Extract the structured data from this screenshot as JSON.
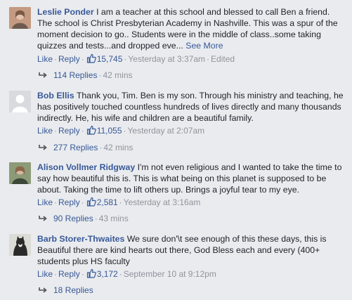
{
  "comments": [
    {
      "author": "Leslie Ponder",
      "text": "I am a teacher at this school and blessed to call Ben a friend. The school is Christ Presbyterian Academy in Nashville. This was a spur of the moment decision to go.. Students were in the middle of class..some taking quizzes and tests...and dropped eve...",
      "see_more": "See More",
      "like_label": "Like",
      "reply_label": "Reply",
      "likes": "15,745",
      "time": "Yesterday at 3:37am",
      "edited": "Edited",
      "replies": "114 Replies",
      "replies_time": "42 mins",
      "avatar_colors": [
        "#b98b74",
        "#6d5a4e"
      ]
    },
    {
      "author": "Bob Ellis",
      "text": "Thank you, Tim. Ben is my son. Through his ministry and teaching, he has positively touched countless hundreds of lives directly and many thousands indirectly. He, his wife and children are a beautiful family.",
      "like_label": "Like",
      "reply_label": "Reply",
      "likes": "11,055",
      "time": "Yesterday at 2:07am",
      "replies": "277 Replies",
      "replies_time": "42 mins",
      "avatar_colors": [
        "#bcc0c8",
        "#ffffff"
      ]
    },
    {
      "author": "Alison Vollmer Ridgway",
      "text": "I'm not even religious and I wanted to take the time to say how beautiful this is. This is what being on this planet is supposed to be about. Taking the time to lift others up. Brings a joyful tear to my eye.",
      "like_label": "Like",
      "reply_label": "Reply",
      "likes": "2,581",
      "time": "Yesterday at 3:16am",
      "replies": "90 Replies",
      "replies_time": "43 mins",
      "avatar_colors": [
        "#7b8a6a",
        "#3e4638"
      ]
    },
    {
      "author": "Barb Storer-Thwaites",
      "text": "We sure don'\\t see enough of this these days, this is Beautiful there are kind hearts out there, God Bless each and every (400+ students plus HS faculty",
      "like_label": "Like",
      "reply_label": "Reply",
      "likes": "3,172",
      "time": "September 10 at 9:12pm",
      "replies": "18 Replies",
      "avatar_colors": [
        "#d7d7d2",
        "#2a2a2a"
      ]
    }
  ],
  "colors": {
    "link": "#385898",
    "meta": "#90949c",
    "text": "#1d2129",
    "background": "#e9ebee"
  }
}
